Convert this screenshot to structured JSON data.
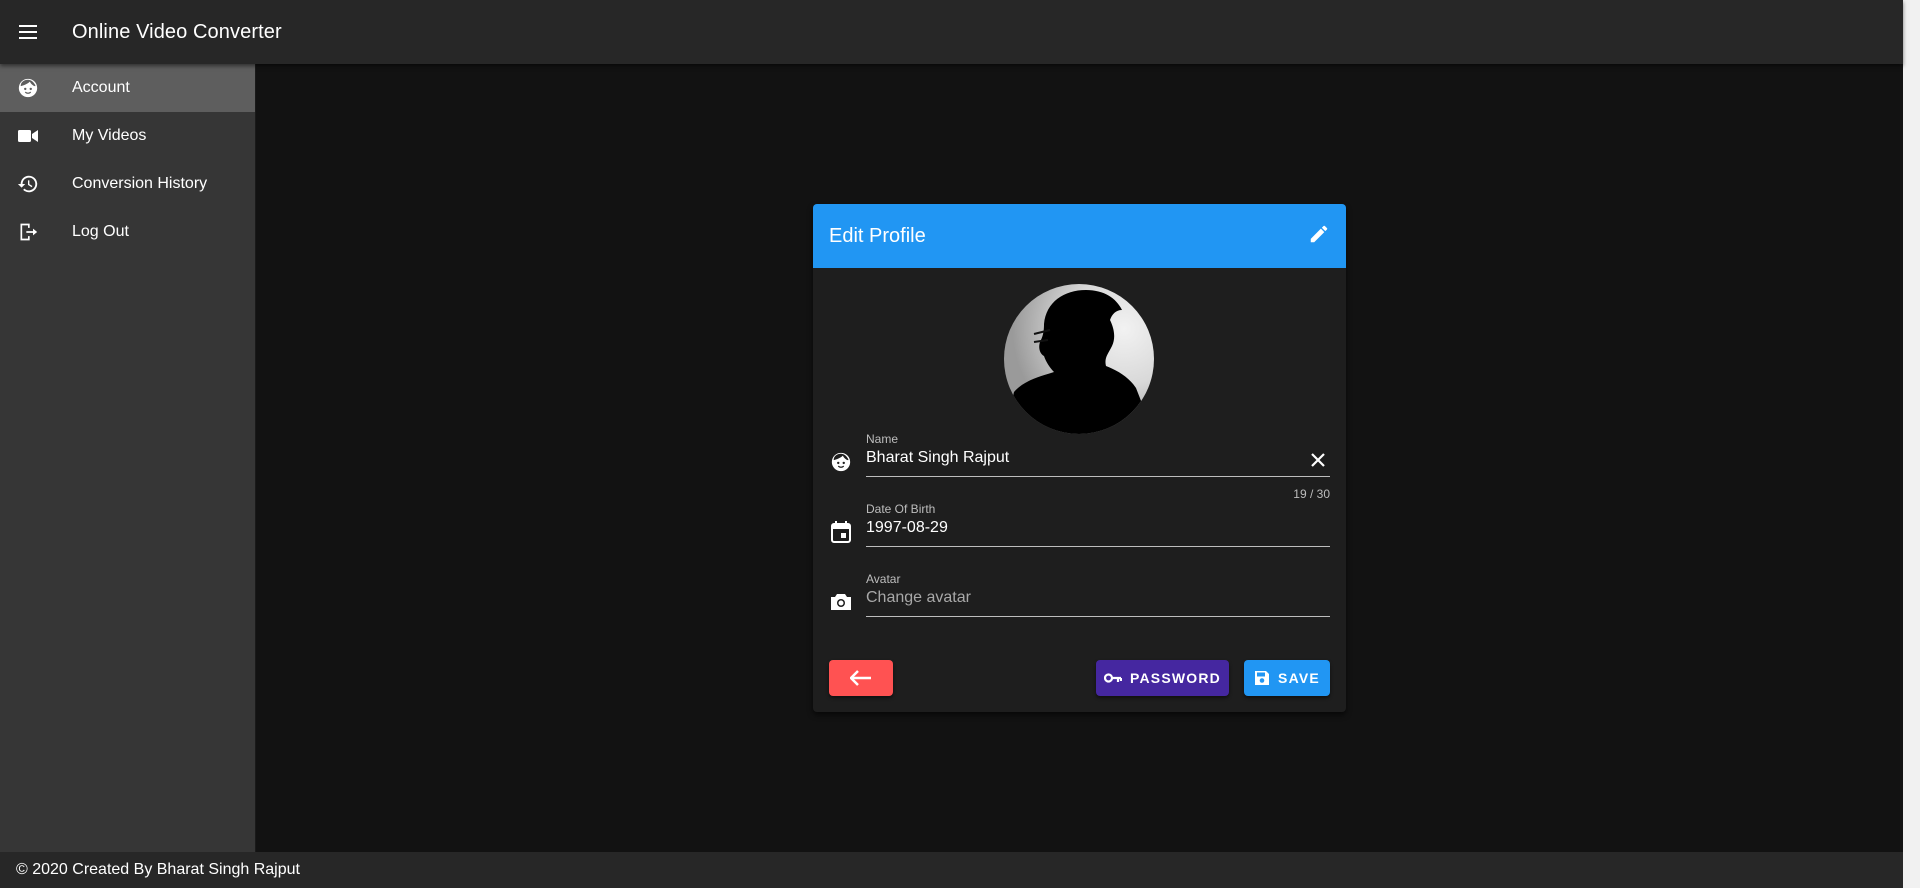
{
  "app": {
    "title": "Online Video Converter"
  },
  "sidebar": {
    "items": [
      {
        "label": "Account",
        "icon": "face-icon",
        "active": true
      },
      {
        "label": "My Videos",
        "icon": "video-camera-icon",
        "active": false
      },
      {
        "label": "Conversion History",
        "icon": "history-icon",
        "active": false
      },
      {
        "label": "Log Out",
        "icon": "logout-icon",
        "active": false
      }
    ]
  },
  "card": {
    "title": "Edit Profile",
    "header_icon": "pencil-icon",
    "header_color": "#2196f3"
  },
  "form": {
    "name": {
      "label": "Name",
      "value": "Bharat Singh Rajput",
      "counter": "19 / 30",
      "icon": "face-icon"
    },
    "dob": {
      "label": "Date Of Birth",
      "value": "1997-08-29",
      "icon": "calendar-icon"
    },
    "avatar": {
      "label": "Avatar",
      "placeholder": "Change avatar",
      "icon": "camera-icon"
    }
  },
  "buttons": {
    "back": {
      "icon": "arrow-left-icon",
      "color": "#ff5252"
    },
    "password": {
      "label": "PASSWORD",
      "icon": "key-icon",
      "color": "#4527a0"
    },
    "save": {
      "label": "SAVE",
      "icon": "save-icon",
      "color": "#2196f3"
    }
  },
  "footer": {
    "text": "© 2020 Created By Bharat Singh Rajput"
  }
}
